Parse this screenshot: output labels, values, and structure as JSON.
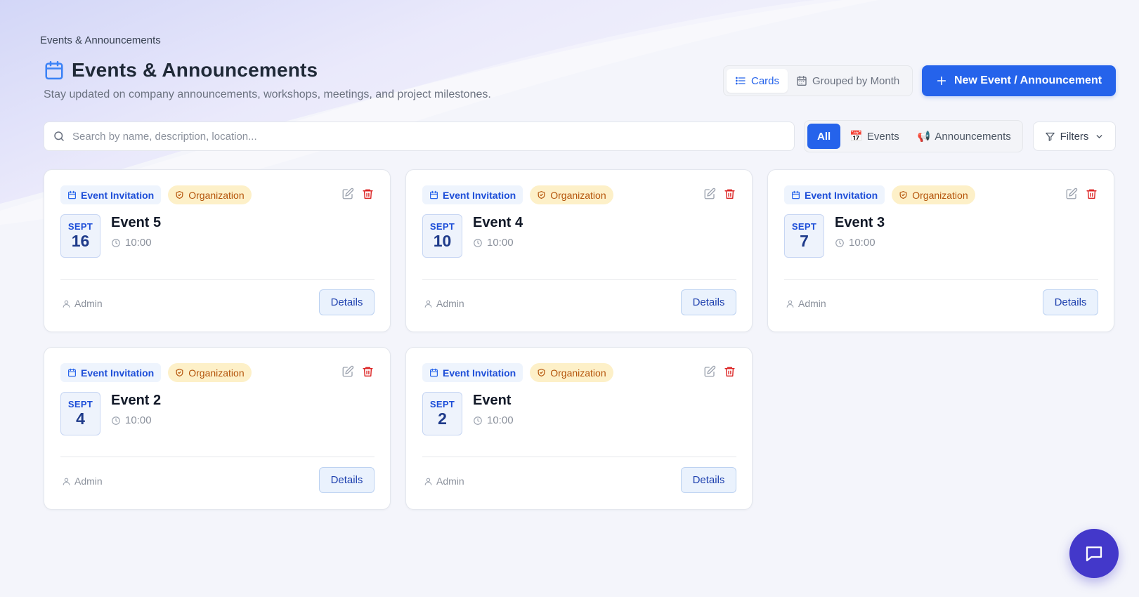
{
  "breadcrumb": "Events & Announcements",
  "header": {
    "title": "Events & Announcements",
    "subtitle": "Stay updated on company announcements, workshops, meetings, and project milestones."
  },
  "view_toggle": {
    "cards_label": "Cards",
    "grouped_label": "Grouped by Month"
  },
  "new_button_label": "New Event / Announcement",
  "search": {
    "placeholder": "Search by name, description, location..."
  },
  "type_filter": {
    "all_label": "All",
    "events_label": "Events",
    "events_icon": "📅",
    "announcements_label": "Announcements",
    "announcements_icon": "📢"
  },
  "filters_label": "Filters",
  "cards": [
    {
      "type": "Event Invitation",
      "scope": "Organization",
      "month": "SEPT",
      "day": "16",
      "name": "Event 5",
      "time": "10:00",
      "author": "Admin",
      "details_label": "Details"
    },
    {
      "type": "Event Invitation",
      "scope": "Organization",
      "month": "SEPT",
      "day": "10",
      "name": "Event 4",
      "time": "10:00",
      "author": "Admin",
      "details_label": "Details"
    },
    {
      "type": "Event Invitation",
      "scope": "Organization",
      "month": "SEPT",
      "day": "7",
      "name": "Event 3",
      "time": "10:00",
      "author": "Admin",
      "details_label": "Details"
    },
    {
      "type": "Event Invitation",
      "scope": "Organization",
      "month": "SEPT",
      "day": "4",
      "name": "Event 2",
      "time": "10:00",
      "author": "Admin",
      "details_label": "Details"
    },
    {
      "type": "Event Invitation",
      "scope": "Organization",
      "month": "SEPT",
      "day": "2",
      "name": "Event",
      "time": "10:00",
      "author": "Admin",
      "details_label": "Details"
    }
  ],
  "colors": {
    "primary": "#2563eb",
    "badge_type_bg": "#eef4fd",
    "badge_scope_bg": "#fdf0c8",
    "delete_red": "#dc2626",
    "chat_fab": "#4338ca"
  }
}
